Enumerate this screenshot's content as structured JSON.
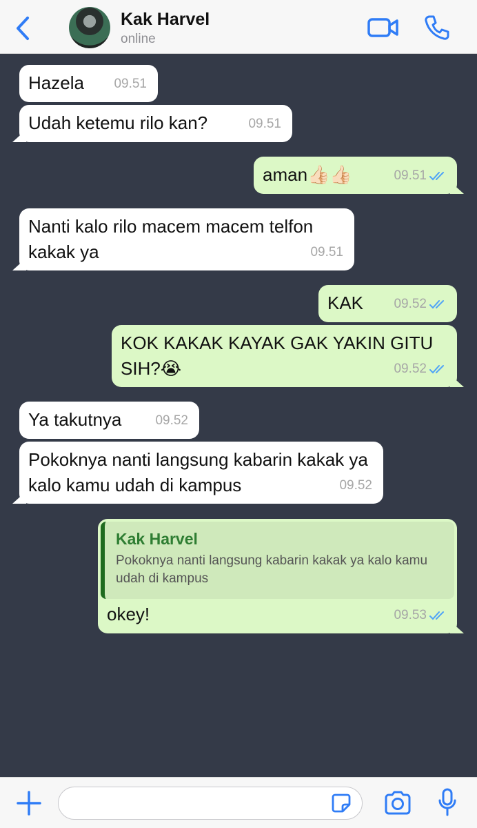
{
  "header": {
    "contact_name": "Kak Harvel",
    "status": "online"
  },
  "messages": [
    {
      "direction": "in",
      "text": "Hazela",
      "time": "09.51"
    },
    {
      "direction": "in",
      "text": "Udah ketemu rilo kan?",
      "time": "09.51"
    },
    {
      "direction": "out",
      "text": "aman👍🏻👍🏻",
      "time": "09.51",
      "read": true
    },
    {
      "direction": "in",
      "text": "Nanti kalo rilo macem macem telfon kakak ya",
      "time": "09.51"
    },
    {
      "direction": "out",
      "text": "KAK",
      "time": "09.52",
      "read": true
    },
    {
      "direction": "out",
      "text": "KOK KAKAK KAYAK GAK YAKIN GITU SIH?😭",
      "time": "09.52",
      "read": true
    },
    {
      "direction": "in",
      "text": "Ya takutnya",
      "time": "09.52"
    },
    {
      "direction": "in",
      "text": "Pokoknya nanti langsung kabarin kakak ya kalo kamu udah di kampus",
      "time": "09.52"
    },
    {
      "direction": "out",
      "text": "okey!",
      "time": "09.53",
      "read": true,
      "reply_to": {
        "name": "Kak Harvel",
        "text": "Pokoknya nanti langsung kabarin kakak ya kalo kamu udah di kampus"
      }
    }
  ],
  "composer": {
    "value": "",
    "placeholder": ""
  },
  "icons": {
    "back": "chevron-left-icon",
    "video": "video-camera-icon",
    "call": "phone-icon",
    "attach": "plus-icon",
    "sticker": "sticker-icon",
    "camera": "camera-icon",
    "mic": "microphone-icon",
    "read_receipt": "double-check-icon"
  },
  "colors": {
    "accent": "#2f7cf6",
    "chat_background": "#343a48",
    "incoming_bubble": "#ffffff",
    "outgoing_bubble": "#dcf8c6",
    "read_tick": "#4fa3f7"
  }
}
